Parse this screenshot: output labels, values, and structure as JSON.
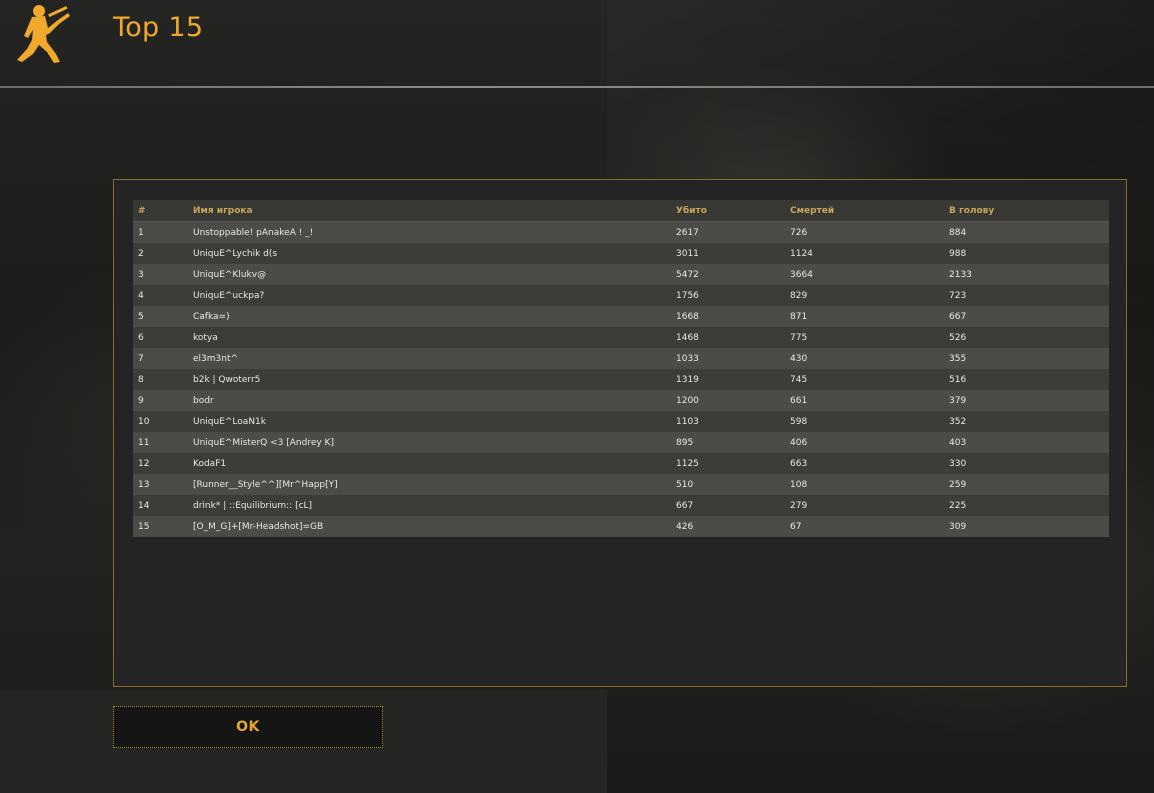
{
  "window": {
    "title": "Top 15",
    "logo_icon": "counter-strike-soldier-icon"
  },
  "colors": {
    "accent": "#f0a92a",
    "panel_border": "#8a6d2a",
    "header_text": "#c6a659",
    "row_odd": "#4b4b47",
    "row_even": "#3c3c39"
  },
  "table": {
    "columns": [
      "#",
      "Имя игрока",
      "Убито",
      "Смертей",
      "В голову"
    ],
    "rows": [
      [
        "1",
        "Unstoppable! pAnakeA ! _!",
        "2617",
        "726",
        "884"
      ],
      [
        "2",
        "UniquE^Lychik d(s",
        "3011",
        "1124",
        "988"
      ],
      [
        "3",
        "UniquE^Klukv@",
        "5472",
        "3664",
        "2133"
      ],
      [
        "4",
        "UniquE^uckpa?",
        "1756",
        "829",
        "723"
      ],
      [
        "5",
        "Cafka=)",
        "1668",
        "871",
        "667"
      ],
      [
        "6",
        "kotya",
        "1468",
        "775",
        "526"
      ],
      [
        "7",
        "el3m3nt^",
        "1033",
        "430",
        "355"
      ],
      [
        "8",
        "b2k | Qwoterr5",
        "1319",
        "745",
        "516"
      ],
      [
        "9",
        "bodr",
        "1200",
        "661",
        "379"
      ],
      [
        "10",
        "UniquE^LoaN1k",
        "1103",
        "598",
        "352"
      ],
      [
        "11",
        "UniquE^MisterQ <3 [Andrey K]",
        "895",
        "406",
        "403"
      ],
      [
        "12",
        "KodaF1",
        "1125",
        "663",
        "330"
      ],
      [
        "13",
        "[Runner__Style^^][Mr^Happ[Y]",
        "510",
        "108",
        "259"
      ],
      [
        "14",
        "drink* | ::Equilibrium:: [cL]",
        "667",
        "279",
        "225"
      ],
      [
        "15",
        "[O_M_G]+[Mr-Headshot]=GB",
        "426",
        "67",
        "309"
      ]
    ]
  },
  "buttons": {
    "ok_label": "OK"
  }
}
